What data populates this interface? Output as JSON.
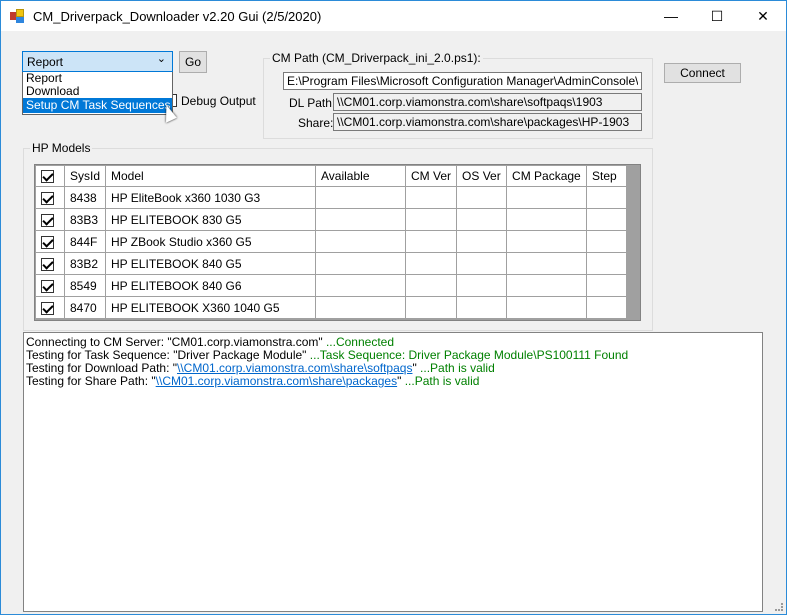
{
  "window": {
    "title": "CM_Driverpack_Downloader v2.20 Gui (2/5/2020)",
    "minimize": "—",
    "maximize": "☐",
    "close": "✕"
  },
  "mode": {
    "selected": "Report",
    "options": [
      "Report",
      "Download",
      "Setup CM Task Sequences"
    ],
    "highlighted": "Setup CM Task Sequences"
  },
  "go_label": "Go",
  "debug_label": "Debug Output",
  "connect_label": "Connect",
  "cm_path": {
    "group_label": "CM Path (CM_Driverpack_ini_2.0.ps1):",
    "path": "E:\\Program Files\\Microsoft Configuration Manager\\AdminConsole\\bin",
    "dl_label": "DL Path:",
    "dl_path": "\\\\CM01.corp.viamonstra.com\\share\\softpaqs\\1903",
    "share_label": "Share:",
    "share_path": "\\\\CM01.corp.viamonstra.com\\share\\packages\\HP-1903"
  },
  "models": {
    "group_label": "HP Models",
    "columns": [
      "SysId",
      "Model",
      "Available",
      "CM Ver",
      "OS Ver",
      "CM Package",
      "Step"
    ],
    "rows": [
      {
        "sysid": "8438",
        "model": "HP EliteBook x360 1030 G3"
      },
      {
        "sysid": "83B3",
        "model": "HP ELITEBOOK 830 G5"
      },
      {
        "sysid": "844F",
        "model": "HP ZBook Studio x360 G5"
      },
      {
        "sysid": "83B2",
        "model": "HP ELITEBOOK 840 G5"
      },
      {
        "sysid": "8549",
        "model": "HP ELITEBOOK 840 G6"
      },
      {
        "sysid": "8470",
        "model": "HP ELITEBOOK X360 1040 G5"
      }
    ]
  },
  "log": [
    {
      "text": "Connecting to CM Server: \"CM01.corp.viamonstra.com\" ",
      "status": "...Connected"
    },
    {
      "text": "Testing for Task Sequence: \"Driver Package Module\" ",
      "status": "...Task Sequence: Driver Package Module\\PS100111 Found"
    },
    {
      "pre": "Testing for Download Path: \"",
      "link": "\\\\CM01.corp.viamonstra.com\\share\\softpaqs",
      "post": "\" ",
      "status": "...Path is valid"
    },
    {
      "pre": "Testing for Share Path: \"",
      "link": "\\\\CM01.corp.viamonstra.com\\share\\packages",
      "post": "\" ",
      "status": "...Path is valid"
    }
  ]
}
